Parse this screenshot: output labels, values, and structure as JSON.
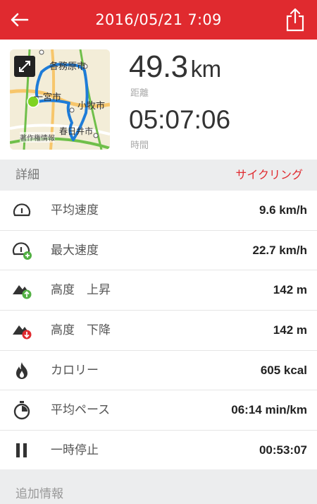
{
  "header": {
    "title": "2016/05/21 7:09",
    "back_icon": "arrow-left-icon",
    "share_icon": "share-icon",
    "color": "#e02a2f"
  },
  "summary": {
    "map": {
      "labels": [
        "各務原市",
        "一宮市",
        "小牧市",
        "春日井市"
      ],
      "credit": "著作権情報",
      "expand_icon": "expand-icon"
    },
    "distance_value": "49.3",
    "distance_unit": "km",
    "distance_label": "距離",
    "time_value": "05:07:06",
    "time_label": "時間"
  },
  "details": {
    "title": "詳細",
    "activity": "サイクリング",
    "rows": [
      {
        "label": "平均速度",
        "value": "9.6 km/h",
        "icon": "speedometer-icon"
      },
      {
        "label": "最大速度",
        "value": "22.7 km/h",
        "icon": "speedometer-plus-icon"
      },
      {
        "label": "高度　上昇",
        "value": "142 m",
        "icon": "elevation-up-icon"
      },
      {
        "label": "高度　下降",
        "value": "142 m",
        "icon": "elevation-down-icon"
      },
      {
        "label": "カロリー",
        "value": "605 kcal",
        "icon": "flame-icon"
      },
      {
        "label": "平均ペース",
        "value": "06:14 min/km",
        "icon": "stopwatch-icon"
      },
      {
        "label": "一時停止",
        "value": "00:53:07",
        "icon": "pause-icon"
      }
    ]
  },
  "additional": {
    "title": "追加情報"
  }
}
